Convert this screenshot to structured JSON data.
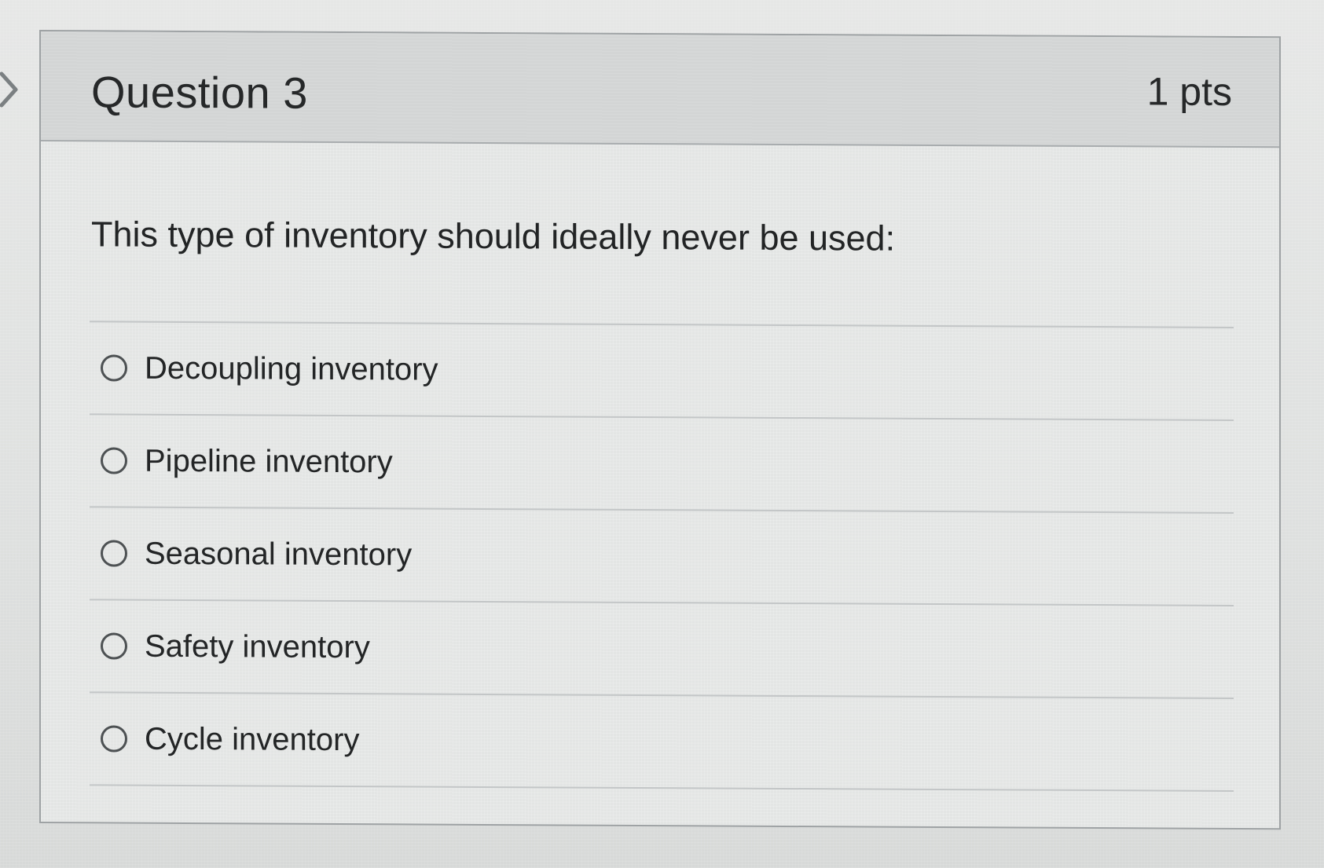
{
  "question": {
    "title": "Question 3",
    "points": "1 pts",
    "prompt": "This type of inventory should ideally never be used:",
    "answers": [
      {
        "label": "Decoupling inventory",
        "selected": false
      },
      {
        "label": "Pipeline inventory",
        "selected": false
      },
      {
        "label": "Seasonal inventory",
        "selected": false
      },
      {
        "label": "Safety inventory",
        "selected": false
      },
      {
        "label": "Cycle inventory",
        "selected": false
      }
    ]
  },
  "icons": {
    "nav": "chevron-right-icon",
    "option": "radio-button-unchecked-icon"
  },
  "colors": {
    "header_bg": "#d3d5d5",
    "card_bg": "#e3e5e4",
    "border": "#9ea2a4",
    "text": "#262829"
  }
}
